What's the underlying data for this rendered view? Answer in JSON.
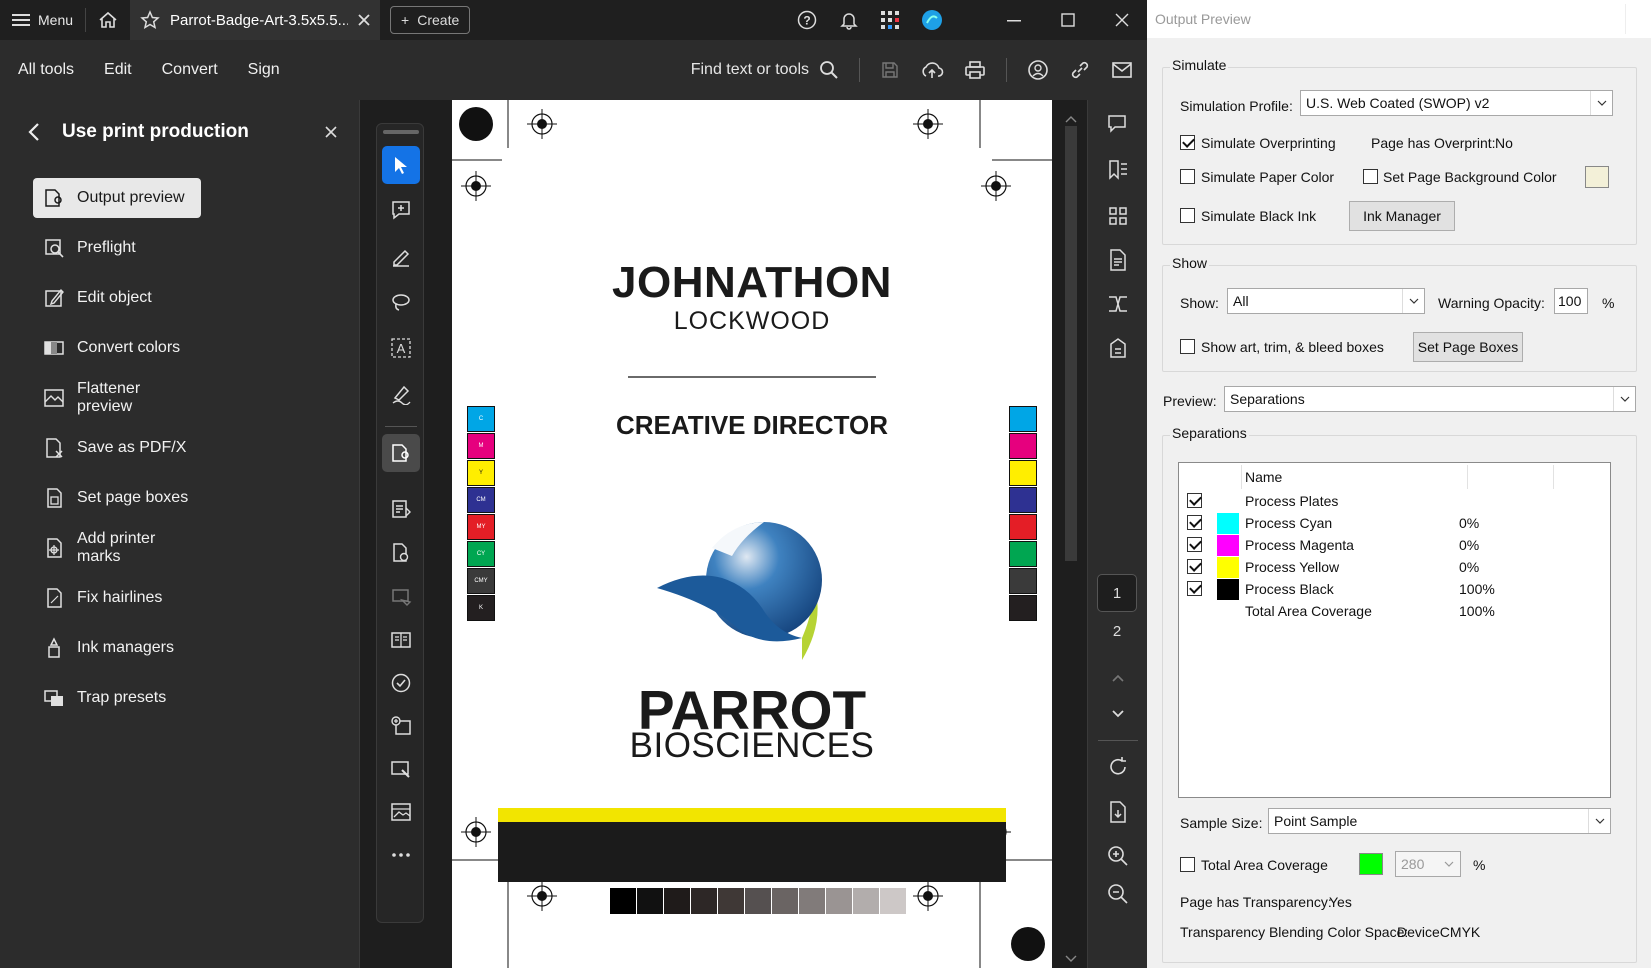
{
  "topbar": {
    "menu_label": "Menu",
    "tab_title": "Parrot-Badge-Art-3.5x5.5...",
    "create_label": "Create"
  },
  "menubar": {
    "items": [
      "All tools",
      "Edit",
      "Convert",
      "Sign"
    ],
    "find_label": "Find text or tools"
  },
  "left_panel": {
    "title": "Use print production",
    "items": [
      {
        "label": "Output preview",
        "icon": "output-preview-icon"
      },
      {
        "label": "Preflight",
        "icon": "preflight-icon"
      },
      {
        "label": "Edit object",
        "icon": "edit-object-icon"
      },
      {
        "label": "Convert colors",
        "icon": "convert-colors-icon"
      },
      {
        "label": "Flattener preview",
        "icon": "flattener-icon"
      },
      {
        "label": "Save as PDF/X",
        "icon": "save-pdfx-icon"
      },
      {
        "label": "Set page boxes",
        "icon": "page-boxes-icon"
      },
      {
        "label": "Add printer marks",
        "icon": "printer-marks-icon"
      },
      {
        "label": "Fix hairlines",
        "icon": "hairlines-icon"
      },
      {
        "label": "Ink managers",
        "icon": "ink-icon"
      },
      {
        "label": "Trap presets",
        "icon": "trap-icon"
      }
    ]
  },
  "document": {
    "first_name": "JOHNATHON",
    "last_name": "LOCKWOOD",
    "role": "CREATIVE DIRECTOR",
    "company_line1": "PARROT",
    "company_line2": "BIOSCIENCES",
    "color_bar_labels": [
      "C",
      "M",
      "Y",
      "CM",
      "MY",
      "CY",
      "CMY",
      "K"
    ],
    "color_bar_colors": [
      "#00a6e6",
      "#e6007e",
      "#ffee00",
      "#2e3192",
      "#e41e26",
      "#00a651",
      "#3a3a3a",
      "#231f20"
    ],
    "gray_steps": [
      "#000000",
      "#111111",
      "#1f1b1a",
      "#2d2726",
      "#3f3836",
      "#555050",
      "#6a6463",
      "#817b7a",
      "#9a9493",
      "#b2adac",
      "#cdc8c7"
    ]
  },
  "page_nav": {
    "pages": [
      "1",
      "2"
    ],
    "current": "1"
  },
  "dialog": {
    "title": "Output Preview",
    "simulate": {
      "group_label": "Simulate",
      "profile_label": "Simulation Profile:",
      "profile_value": "U.S. Web Coated (SWOP) v2",
      "overprint_label": "Simulate Overprinting",
      "overprint_checked": true,
      "page_overprint_label": "Page has Overprint:",
      "page_overprint_value": "No",
      "paper_color_label": "Simulate Paper Color",
      "bg_color_label": "Set Page Background Color",
      "black_ink_label": "Simulate Black Ink",
      "ink_manager_label": "Ink Manager"
    },
    "show": {
      "group_label": "Show",
      "show_label": "Show:",
      "show_value": "All",
      "opacity_label": "Warning Opacity:",
      "opacity_value": "100",
      "opacity_unit": "%",
      "boxes_label": "Show art, trim, & bleed boxes",
      "set_boxes_label": "Set Page Boxes"
    },
    "preview": {
      "label": "Preview:",
      "value": "Separations"
    },
    "separations": {
      "group_label": "Separations",
      "header_name": "Name",
      "rows": [
        {
          "name": "Process Plates",
          "percent": "",
          "swatch": "",
          "checked": true
        },
        {
          "name": "Process Cyan",
          "percent": "0%",
          "swatch": "#00ffff",
          "checked": true
        },
        {
          "name": "Process Magenta",
          "percent": "0%",
          "swatch": "#ff00ff",
          "checked": true
        },
        {
          "name": "Process Yellow",
          "percent": "0%",
          "swatch": "#ffff00",
          "checked": true
        },
        {
          "name": "Process Black",
          "percent": "100%",
          "swatch": "#000000",
          "checked": true
        },
        {
          "name": "Total Area Coverage",
          "percent": "100%",
          "swatch": "",
          "checked": false
        }
      ]
    },
    "sample": {
      "label": "Sample Size:",
      "value": "Point Sample"
    },
    "tac": {
      "label": "Total Area Coverage",
      "value": "280",
      "unit": "%",
      "swatch": "#00ff00"
    },
    "transparency": {
      "label": "Page has Transparency:",
      "value": "Yes"
    },
    "blending": {
      "label": "Transparency Blending Color Space:",
      "value": "DeviceCMYK"
    }
  }
}
